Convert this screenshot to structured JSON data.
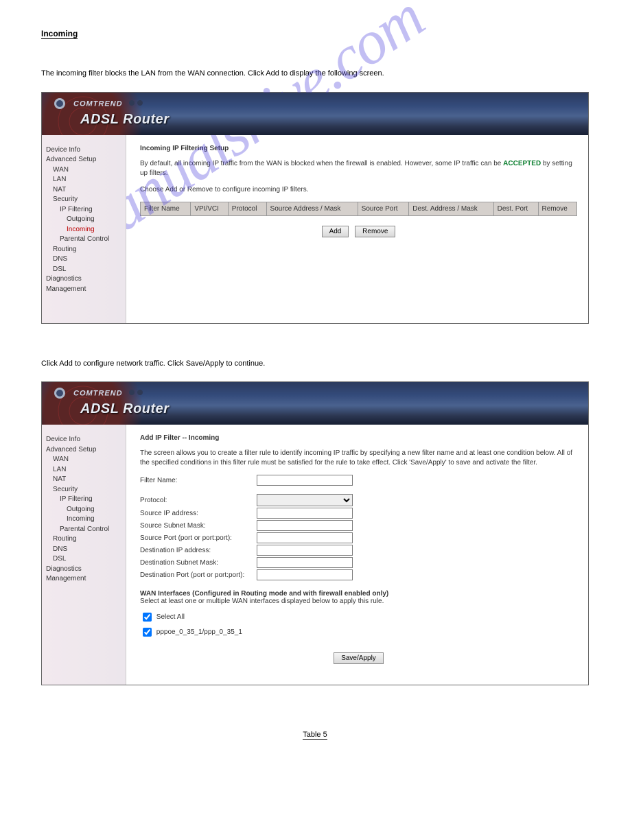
{
  "watermark": "manualshive.com",
  "section": {
    "heading": "Incoming",
    "intro": "The incoming filter blocks the LAN from the WAN connection. Click Add to display the following screen.",
    "after_text": "Click Add to configure network traffic. Click Save/Apply to continue.",
    "table_ref": "Table 5"
  },
  "brand": "COMTREND",
  "product": "ADSL Router",
  "sidebar": {
    "items": [
      {
        "label": "Device Info",
        "level": 1
      },
      {
        "label": "Advanced Setup",
        "level": 1
      },
      {
        "label": "WAN",
        "level": 2
      },
      {
        "label": "LAN",
        "level": 2
      },
      {
        "label": "NAT",
        "level": 2
      },
      {
        "label": "Security",
        "level": 2
      },
      {
        "label": "IP Filtering",
        "level": 3
      },
      {
        "label": "Outgoing",
        "level": 4
      },
      {
        "label": "Incoming",
        "level": 4,
        "active": true
      },
      {
        "label": "Parental Control",
        "level": 3
      },
      {
        "label": "Routing",
        "level": 2
      },
      {
        "label": "DNS",
        "level": 2
      },
      {
        "label": "DSL",
        "level": 2
      },
      {
        "label": "Diagnostics",
        "level": 1
      },
      {
        "label": "Management",
        "level": 1
      }
    ]
  },
  "sidebar2": {
    "items": [
      {
        "label": "Device Info",
        "level": 1
      },
      {
        "label": "Advanced Setup",
        "level": 1
      },
      {
        "label": "WAN",
        "level": 2
      },
      {
        "label": "LAN",
        "level": 2
      },
      {
        "label": "NAT",
        "level": 2
      },
      {
        "label": "Security",
        "level": 2
      },
      {
        "label": "IP Filtering",
        "level": 3
      },
      {
        "label": "Outgoing",
        "level": 4
      },
      {
        "label": "Incoming",
        "level": 4
      },
      {
        "label": "Parental Control",
        "level": 3
      },
      {
        "label": "Routing",
        "level": 2
      },
      {
        "label": "DNS",
        "level": 2
      },
      {
        "label": "DSL",
        "level": 2
      },
      {
        "label": "Diagnostics",
        "level": 1
      },
      {
        "label": "Management",
        "level": 1
      }
    ]
  },
  "screen1": {
    "title": "Incoming IP Filtering Setup",
    "desc1a": "By default, all incoming IP traffic from the WAN is blocked when the firewall is enabled. However, some IP traffic can be",
    "accepted": "ACCEPTED",
    "desc1b": " by setting up filters.",
    "desc2": "Choose Add or Remove to configure incoming IP filters.",
    "columns": [
      "Filter Name",
      "VPI/VCI",
      "Protocol",
      "Source Address / Mask",
      "Source Port",
      "Dest. Address / Mask",
      "Dest. Port",
      "Remove"
    ],
    "buttons": {
      "add": "Add",
      "remove": "Remove"
    }
  },
  "screen2": {
    "title": "Add IP Filter -- Incoming",
    "desc": "The screen allows you to create a filter rule to identify incoming IP traffic by specifying a new filter name and at least one condition below. All of the specified conditions in this filter rule must be satisfied for the rule to take effect. Click 'Save/Apply' to save and activate the filter.",
    "fields": {
      "filter_name": "Filter Name:",
      "protocol": "Protocol:",
      "src_ip": "Source IP address:",
      "src_mask": "Source Subnet Mask:",
      "src_port": "Source Port (port or port:port):",
      "dst_ip": "Destination IP address:",
      "dst_mask": "Destination Subnet Mask:",
      "dst_port": "Destination Port (port or port:port):"
    },
    "wan_heading": "WAN Interfaces (Configured in Routing mode and with firewall enabled only)",
    "wan_sub": "Select at least one or multiple WAN interfaces displayed below to apply this rule.",
    "checks": {
      "select_all": "Select All",
      "iface1": "pppoe_0_35_1/ppp_0_35_1"
    },
    "save": "Save/Apply"
  }
}
